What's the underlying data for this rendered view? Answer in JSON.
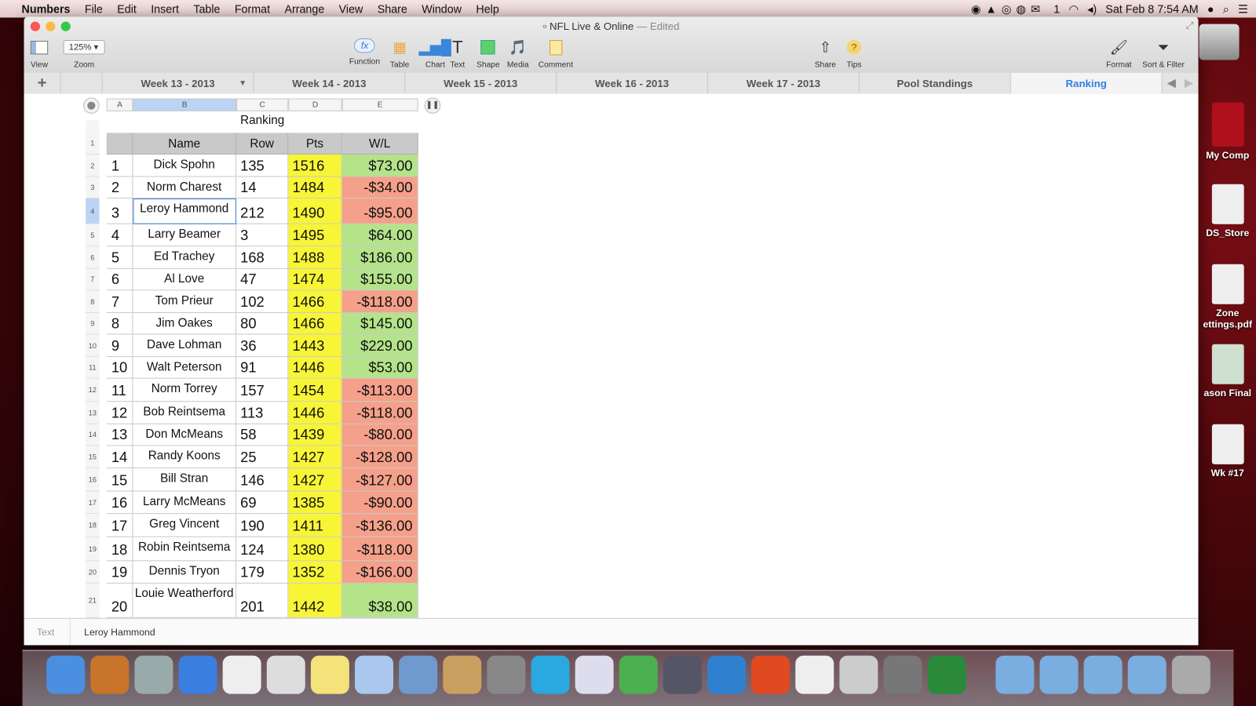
{
  "menubar": {
    "app": "Numbers",
    "items": [
      "File",
      "Edit",
      "Insert",
      "Table",
      "Format",
      "Arrange",
      "View",
      "Share",
      "Window",
      "Help"
    ],
    "mail_count": "1",
    "clock": "Sat Feb 8  7:54 AM"
  },
  "window": {
    "title": "NFL Live & Online",
    "edited": "— Edited"
  },
  "toolbar": {
    "view": "View",
    "zoom_value": "125%",
    "zoom": "Zoom",
    "function": "Function",
    "table": "Table",
    "chart": "Chart",
    "text": "Text",
    "shape": "Shape",
    "media": "Media",
    "comment": "Comment",
    "share": "Share",
    "tips": "Tips",
    "format": "Format",
    "sort_filter": "Sort & Filter"
  },
  "tabs": [
    "Week 13 - 2013",
    "Week 14 - 2013",
    "Week 15 - 2013",
    "Week 16 - 2013",
    "Week 17 - 2013",
    "Pool Standings",
    "Ranking"
  ],
  "active_tab": "Ranking",
  "sheet": {
    "columns": [
      "A",
      "B",
      "C",
      "D",
      "E"
    ],
    "selected_column": "B",
    "selected_row": 4,
    "table_title": "Ranking",
    "headers": [
      "",
      "Name",
      "Row",
      "Pts",
      "W/L"
    ],
    "rows": [
      [
        "1",
        "Dick Spohn",
        "135",
        "1516",
        "$73.00"
      ],
      [
        "2",
        "Norm Charest",
        "14",
        "1484",
        "-$34.00"
      ],
      [
        "3",
        "Leroy Hammond",
        "212",
        "1490",
        "-$95.00"
      ],
      [
        "4",
        "Larry Beamer",
        "3",
        "1495",
        "$64.00"
      ],
      [
        "5",
        "Ed Trachey",
        "168",
        "1488",
        "$186.00"
      ],
      [
        "6",
        "Al Love",
        "47",
        "1474",
        "$155.00"
      ],
      [
        "7",
        "Tom Prieur",
        "102",
        "1466",
        "-$118.00"
      ],
      [
        "8",
        "Jim Oakes",
        "80",
        "1466",
        "$145.00"
      ],
      [
        "9",
        "Dave Lohman",
        "36",
        "1443",
        "$229.00"
      ],
      [
        "10",
        "Walt Peterson",
        "91",
        "1446",
        "$53.00"
      ],
      [
        "11",
        "Norm Torrey",
        "157",
        "1454",
        "-$113.00"
      ],
      [
        "12",
        "Bob Reintsema",
        "113",
        "1446",
        "-$118.00"
      ],
      [
        "13",
        "Don McMeans",
        "58",
        "1439",
        "-$80.00"
      ],
      [
        "14",
        "Randy Koons",
        "25",
        "1427",
        "-$128.00"
      ],
      [
        "15",
        "Bill Stran",
        "146",
        "1427",
        "-$127.00"
      ],
      [
        "16",
        "Larry McMeans",
        "69",
        "1385",
        "-$90.00"
      ],
      [
        "17",
        "Greg Vincent",
        "190",
        "1411",
        "-$136.00"
      ],
      [
        "18",
        "Robin Reintsema",
        "124",
        "1380",
        "-$118.00"
      ],
      [
        "19",
        "Dennis Tryon",
        "179",
        "1352",
        "-$166.00"
      ],
      [
        "20",
        "Louie Weatherford",
        "201",
        "1442",
        "$38.00"
      ]
    ]
  },
  "colors": {
    "pts": "#f7f536",
    "positive": "#b4e38a",
    "negative": "#f4a08a",
    "header": "#c9c9c9",
    "accent": "#2f7fe8"
  },
  "formula_bar": {
    "label": "Text",
    "value": "Leroy Hammond"
  },
  "desktop": [
    "My Comp",
    "DS_Store",
    "Zone ettings.pdf",
    "ason Final",
    "Wk #17"
  ]
}
